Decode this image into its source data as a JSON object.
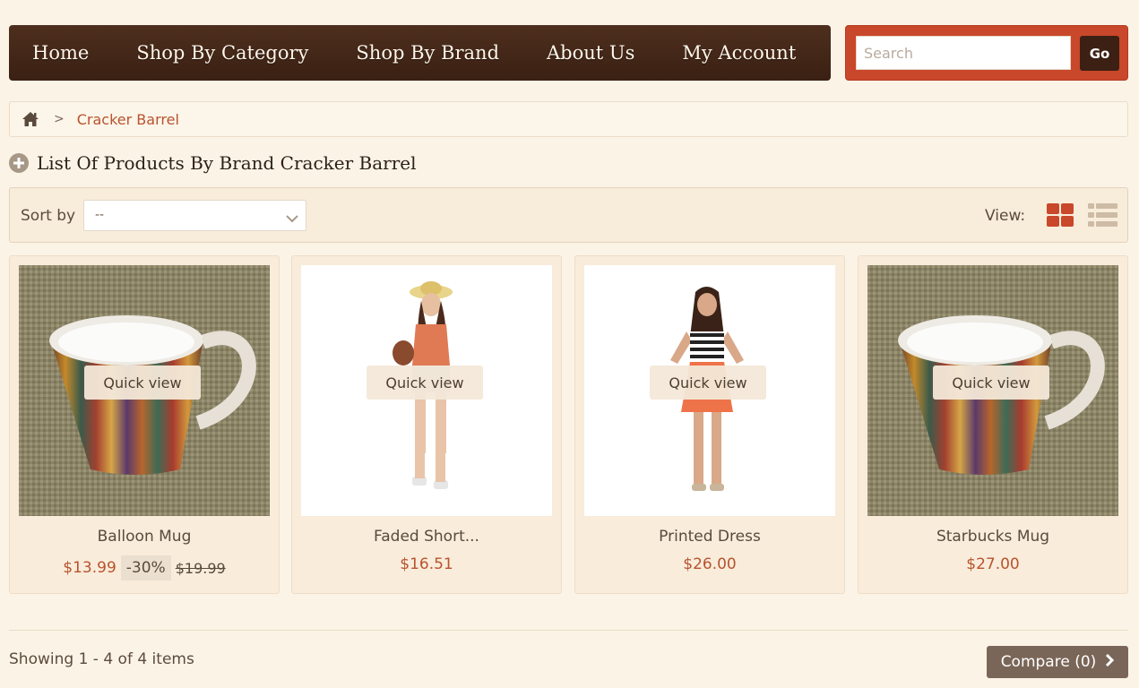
{
  "nav": {
    "items": [
      "Home",
      "Shop By Category",
      "Shop By Brand",
      "About Us",
      "My Account"
    ]
  },
  "search": {
    "placeholder": "Search",
    "value": "",
    "button_label": "Go"
  },
  "breadcrumb": {
    "home_icon": "home-icon",
    "separator": ">",
    "current": "Cracker Barrel"
  },
  "heading": {
    "icon": "plus-circle-icon",
    "title": "List Of Products By Brand Cracker Barrel"
  },
  "sort": {
    "label": "Sort by",
    "selected": "--"
  },
  "view": {
    "label": "View:",
    "active": "grid",
    "grid_icon": "grid-view-icon",
    "list_icon": "list-view-icon"
  },
  "products": [
    {
      "name": "Balloon Mug",
      "price": "$13.99",
      "discount": "-30%",
      "old_price": "$19.99",
      "quick_view": "Quick view",
      "image": "striped-mug"
    },
    {
      "name": "Faded Short...",
      "price": "$16.51",
      "discount": "",
      "old_price": "",
      "quick_view": "Quick view",
      "image": "woman-hat-shorts"
    },
    {
      "name": "Printed Dress",
      "price": "$26.00",
      "discount": "",
      "old_price": "",
      "quick_view": "Quick view",
      "image": "woman-striped-dress"
    },
    {
      "name": "Starbucks Mug",
      "price": "$27.00",
      "discount": "",
      "old_price": "",
      "quick_view": "Quick view",
      "image": "striped-mug"
    }
  ],
  "footer": {
    "showing": "Showing 1 - 4 of 4 items",
    "compare_label": "Compare (0)"
  },
  "colors": {
    "accent": "#c9472a",
    "nav_bg": "#3a2013",
    "price": "#b8532e",
    "page_bg": "#fbf4e6"
  }
}
